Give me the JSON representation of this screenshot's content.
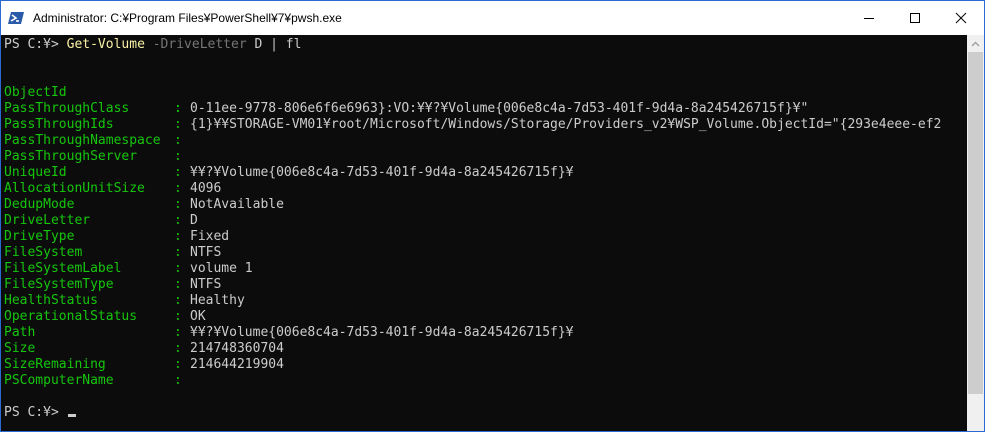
{
  "window": {
    "title": "Administrator: C:¥Program Files¥PowerShell¥7¥pwsh.exe",
    "icon": "powershell-icon",
    "controls": [
      "minimize-icon",
      "maximize-icon",
      "close-icon"
    ]
  },
  "console": {
    "prompt1": "PS C:¥> ",
    "command_name": "Get-Volume",
    "command_param": " -DriveLetter",
    "command_arg": " D",
    "command_pipe": " | fl",
    "object_id": {
      "name": "ObjectId",
      "sep": ":",
      "value_line1": "{1}¥¥STORAGE-VM01¥root/Microsoft/Windows/Storage/Providers_v2¥WSP_Volume.ObjectId=\"{293e4eee-ef2",
      "value_line2": "0-11ee-9778-806e6f6e6963}:VO:¥¥?¥Volume{006e8c4a-7d53-401f-9d4a-8a245426715f}¥\""
    },
    "properties": [
      {
        "name": "PassThroughClass",
        "sep": ":",
        "value": ""
      },
      {
        "name": "PassThroughIds",
        "sep": ":",
        "value": ""
      },
      {
        "name": "PassThroughNamespace",
        "sep": ":",
        "value": ""
      },
      {
        "name": "PassThroughServer",
        "sep": ":",
        "value": ""
      },
      {
        "name": "UniqueId",
        "sep": ":",
        "value": "¥¥?¥Volume{006e8c4a-7d53-401f-9d4a-8a245426715f}¥"
      },
      {
        "name": "AllocationUnitSize",
        "sep": ":",
        "value": "4096"
      },
      {
        "name": "DedupMode",
        "sep": ":",
        "value": "NotAvailable"
      },
      {
        "name": "DriveLetter",
        "sep": ":",
        "value": "D"
      },
      {
        "name": "DriveType",
        "sep": ":",
        "value": "Fixed"
      },
      {
        "name": "FileSystem",
        "sep": ":",
        "value": "NTFS"
      },
      {
        "name": "FileSystemLabel",
        "sep": ":",
        "value": "volume 1"
      },
      {
        "name": "FileSystemType",
        "sep": ":",
        "value": "NTFS"
      },
      {
        "name": "HealthStatus",
        "sep": ":",
        "value": "Healthy"
      },
      {
        "name": "OperationalStatus",
        "sep": ":",
        "value": "OK"
      },
      {
        "name": "Path",
        "sep": ":",
        "value": "¥¥?¥Volume{006e8c4a-7d53-401f-9d4a-8a245426715f}¥"
      },
      {
        "name": "Size",
        "sep": ":",
        "value": "214748360704"
      },
      {
        "name": "SizeRemaining",
        "sep": ":",
        "value": "214644219904"
      },
      {
        "name": "PSComputerName",
        "sep": ":",
        "value": ""
      }
    ],
    "prompt2": "PS C:¥> "
  },
  "colors": {
    "background": "#0c0c0c",
    "property_name": "#16c60c",
    "command_name": "#f9f1a5",
    "parameter": "#767676",
    "text": "#cccccc"
  }
}
